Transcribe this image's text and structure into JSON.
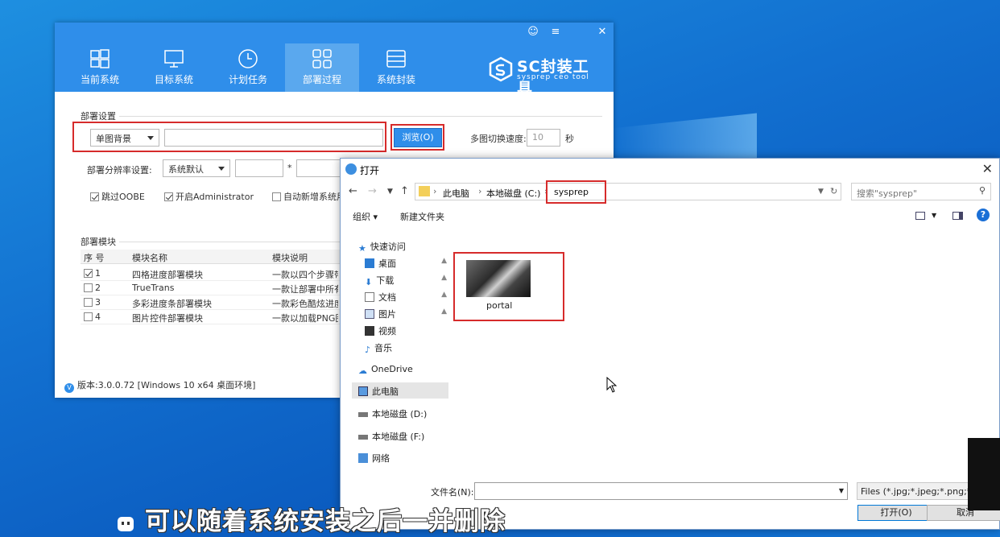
{
  "sc": {
    "nav": [
      {
        "label": "当前系统",
        "icon": "windows-icon"
      },
      {
        "label": "目标系统",
        "icon": "monitor-icon"
      },
      {
        "label": "计划任务",
        "icon": "clock-icon"
      },
      {
        "label": "部署过程",
        "icon": "grid-icon",
        "active": true
      },
      {
        "label": "系统封装",
        "icon": "drive-icon"
      }
    ],
    "logo_title": "SC封装工具",
    "logo_sub": "sysprep ceo tool",
    "deploy_settings_title": "部署设置",
    "bg_mode": "单图背景",
    "image_path": "",
    "browse_label": "浏览(O)",
    "switch_speed_label": "多图切换速度:",
    "switch_speed_value": "10",
    "switch_speed_unit": "秒",
    "resolution_label": "部署分辨率设置:",
    "resolution_value": "系统默认",
    "resolution_sep": "*",
    "checks": [
      {
        "label": "跳过OOBE",
        "checked": true
      },
      {
        "label": "开启Administrator",
        "checked": true
      },
      {
        "label": "自动新增系统用",
        "checked": false
      }
    ],
    "modules_title": "部署模块",
    "table_headers": [
      "序 号",
      "模块名称",
      "模块说明"
    ],
    "table_rows": [
      {
        "no": "1",
        "name": "四格进度部署模块",
        "desc": "一款以四个步骤带",
        "checked": true
      },
      {
        "no": "2",
        "name": "TrueTrans",
        "desc": "一款让部署中所有",
        "checked": false
      },
      {
        "no": "3",
        "name": "多彩进度条部署模块",
        "desc": "一款彩色酷炫进度",
        "checked": false
      },
      {
        "no": "4",
        "name": "图片控件部署模块",
        "desc": "一款以加载PNG图",
        "checked": false
      }
    ],
    "version": "版本:3.0.0.72 [Windows 10 x64 桌面环境]"
  },
  "dialog": {
    "title": "打开",
    "path": [
      "此电脑",
      "本地磁盘 (C:)",
      "sysprep"
    ],
    "search_placeholder": "搜索\"sysprep\"",
    "organize": "组织 ▾",
    "new_folder": "新建文件夹",
    "sidebar": [
      {
        "label": "快速访问",
        "icon": "star-icon"
      },
      {
        "label": "桌面",
        "icon": "desktop-icon",
        "pinned": true
      },
      {
        "label": "下载",
        "icon": "download-icon",
        "pinned": true
      },
      {
        "label": "文档",
        "icon": "document-icon",
        "pinned": true
      },
      {
        "label": "图片",
        "icon": "pictures-icon",
        "pinned": true
      },
      {
        "label": "视频",
        "icon": "video-icon"
      },
      {
        "label": "音乐",
        "icon": "music-icon"
      },
      {
        "label": "OneDrive",
        "icon": "cloud-icon"
      },
      {
        "label": "此电脑",
        "icon": "computer-icon",
        "selected": true
      },
      {
        "label": "本地磁盘 (D:)",
        "icon": "drive-icon"
      },
      {
        "label": "本地磁盘 (F:)",
        "icon": "drive-icon"
      },
      {
        "label": "网络",
        "icon": "network-icon"
      }
    ],
    "file_name": "portal",
    "filename_label": "文件名(N):",
    "filename_value": "",
    "filetype": "Files (*.jpg;*.jpeg;*.png;*.bmp)",
    "open_btn": "打开(O)",
    "cancel_btn": "取消"
  },
  "subtitle": "可以随着系统安装之后一并删除"
}
